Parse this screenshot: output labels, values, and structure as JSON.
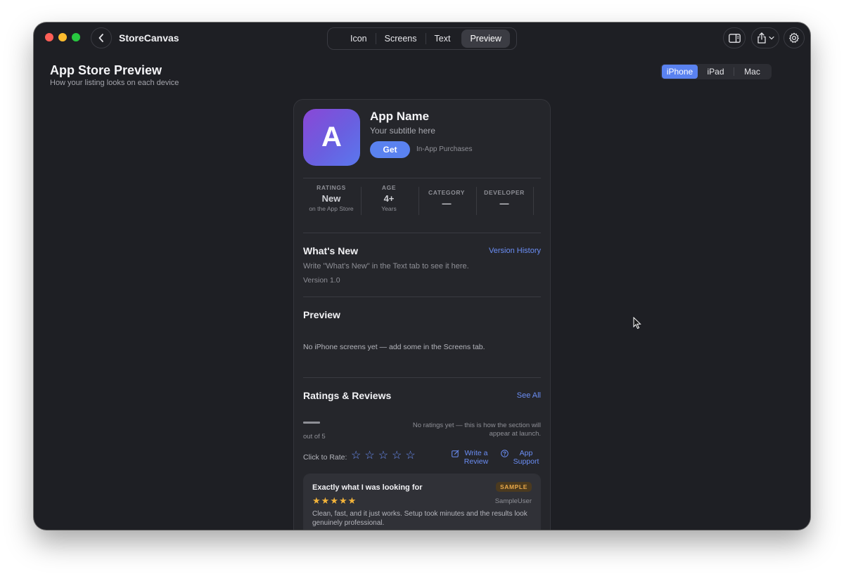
{
  "app": {
    "title": "StoreCanvas"
  },
  "toolbar": {
    "tabs": [
      {
        "label": "Icon"
      },
      {
        "label": "Screens"
      },
      {
        "label": "Text"
      },
      {
        "label": "Preview"
      }
    ],
    "active_tab": "Preview",
    "icons": [
      "sidebar-toggle-icon",
      "share-icon",
      "gear-icon"
    ]
  },
  "header": {
    "title": "App Store Preview",
    "subtitle": "How your listing looks on each device"
  },
  "device_selector": {
    "options": [
      {
        "label": "iPhone"
      },
      {
        "label": "iPad"
      },
      {
        "label": "Mac"
      }
    ],
    "selected": "iPhone"
  },
  "listing": {
    "icon_letter": "A",
    "app_name": "App Name",
    "subtitle": "Your subtitle here",
    "get_label": "Get",
    "iap_label": "In-App Purchases",
    "stats": [
      {
        "key": "RATINGS",
        "value": "New",
        "sub": "on the App Store"
      },
      {
        "key": "AGE",
        "value": "4+",
        "sub": "Years"
      },
      {
        "key": "CATEGORY",
        "value": "—",
        "sub": ""
      },
      {
        "key": "DEVELOPER",
        "value": "—",
        "sub": ""
      }
    ],
    "whats_new": {
      "title": "What's New",
      "link": "Version History",
      "placeholder": "Write \"What's New\" in the Text tab to see it here.",
      "version": "Version 1.0"
    },
    "preview": {
      "title": "Preview",
      "empty_text": "No iPhone screens yet — add some in the Screens tab."
    },
    "ratings": {
      "title": "Ratings & Reviews",
      "link": "See All",
      "out_of": "out of 5",
      "no_ratings": "No ratings yet — this is how the section will appear at launch.",
      "click_to_rate": "Click to Rate:",
      "write_review": "Write a Review",
      "app_support": "App Support",
      "review": {
        "title": "Exactly what I was looking for",
        "badge": "SAMPLE",
        "stars": 5,
        "user": "SampleUser",
        "body": "Clean, fast, and it just works. Setup took minutes and the results look genuinely professional."
      }
    }
  },
  "colors": {
    "accent": "#5a82f0",
    "link": "#6b8ef5",
    "window_bg": "#1e1f24",
    "card_bg": "#25262b",
    "badge": "#e8a84a",
    "star": "#f2b33a"
  }
}
